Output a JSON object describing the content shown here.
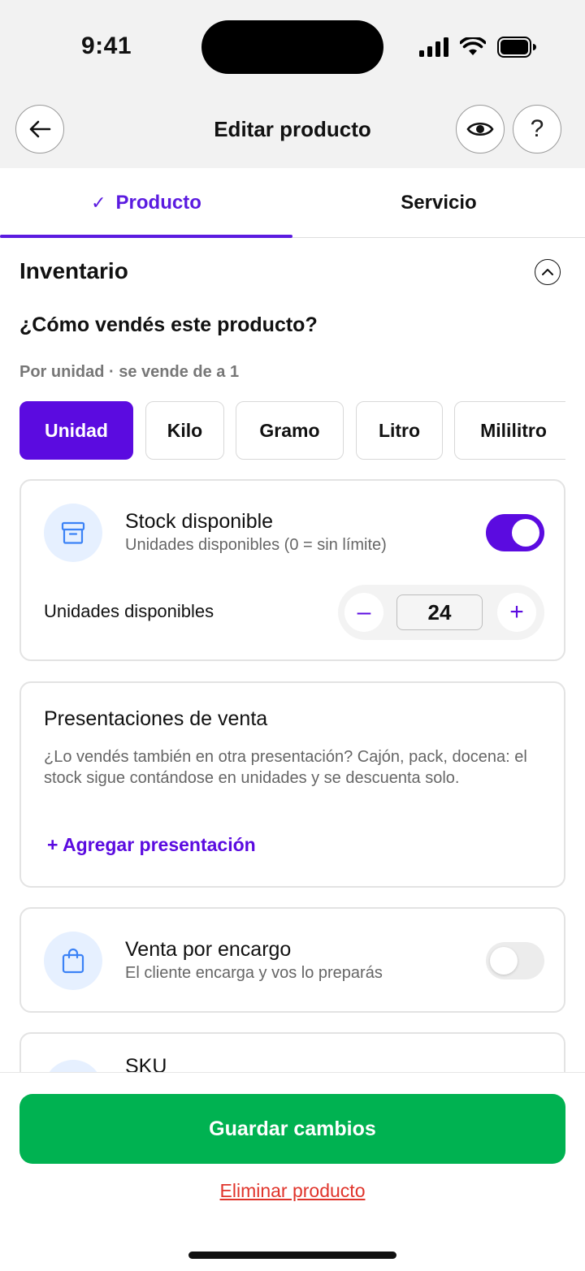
{
  "status_bar": {
    "time": "9:41"
  },
  "header": {
    "title": "Editar producto",
    "help_label": "?"
  },
  "tabs": [
    {
      "label": "Producto",
      "check": "✓",
      "active": true
    },
    {
      "label": "Servicio",
      "active": false
    }
  ],
  "inventory": {
    "title": "Inventario",
    "question": "¿Cómo vendés este producto?",
    "sub_question": "Por unidad · se vende de a 1",
    "units": [
      "Unidad",
      "Kilo",
      "Gramo",
      "Litro",
      "Mililitro"
    ],
    "selected_unit": "Unidad"
  },
  "stock_card": {
    "title": "Stock disponible",
    "subtitle": "Unidades disponibles (0 = sin límite)",
    "toggle_on": true,
    "units_label": "Unidades disponibles",
    "value": "24",
    "minus": "–",
    "plus": "+"
  },
  "presentations_card": {
    "title": "Presentaciones de venta",
    "description": "¿Lo vendés también en otra presentación? Cajón, pack, docena: el stock sigue contándose en unidades y se descuenta solo.",
    "add_link": "+ Agregar presentación"
  },
  "order_card": {
    "title": "Venta por encargo",
    "subtitle": "El cliente encarga y vos lo preparás",
    "toggle_on": false
  },
  "sku_card": {
    "title": "SKU"
  },
  "footer": {
    "save_label": "Guardar cambios",
    "delete_label": "Eliminar producto"
  },
  "colors": {
    "accent": "#5b0be0",
    "save_green": "#00b251",
    "delete_red": "#e0342b",
    "icon_bubble": "#e6f0ff"
  }
}
